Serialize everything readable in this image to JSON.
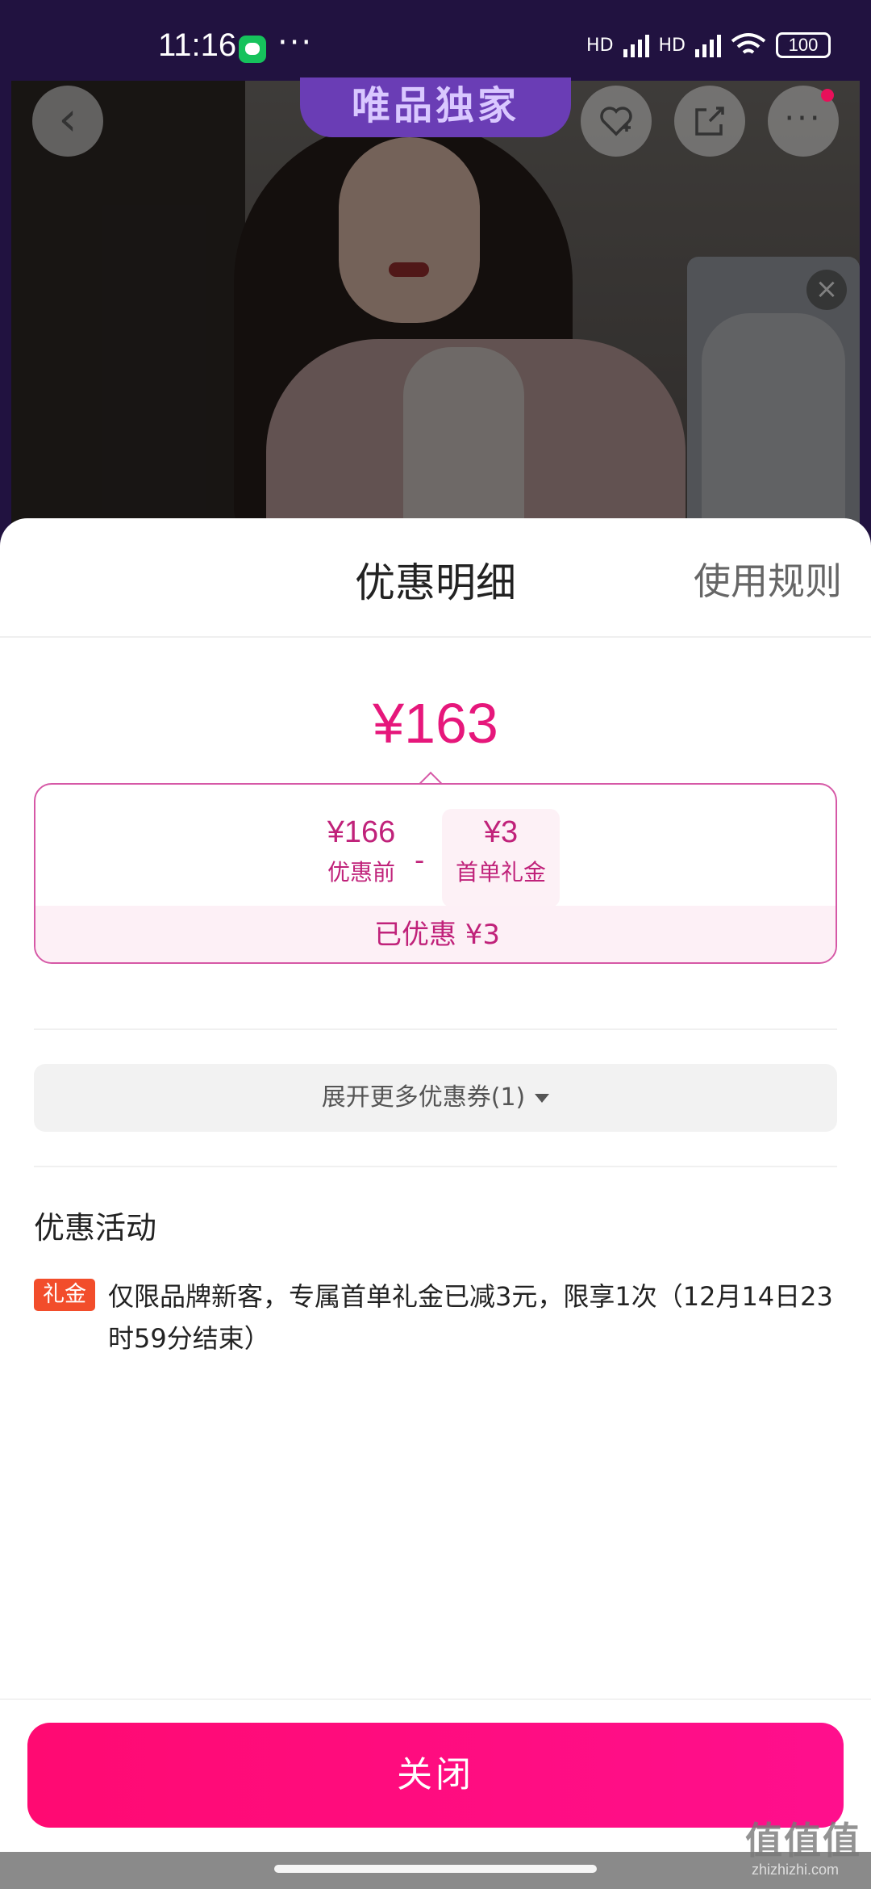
{
  "status_bar": {
    "time": "11:16",
    "dots": "···",
    "signal_label": "HD",
    "battery": "100"
  },
  "product_page": {
    "banner": "唯品独家"
  },
  "sheet": {
    "title": "优惠明细",
    "rules_link": "使用规则",
    "final_price": "¥163",
    "calc": {
      "before_amount": "¥166",
      "before_label": "优惠前",
      "minus": "-",
      "gift_amount": "¥3",
      "gift_label": "首单礼金",
      "saved": "已优惠 ¥3"
    },
    "expand_coupons": "展开更多优惠券(1)",
    "promo_section_title": "优惠活动",
    "promos": [
      {
        "tag": "礼金",
        "text": "仅限品牌新客，专属首单礼金已减3元，限享1次（12月14日23时59分结束）"
      }
    ],
    "close_button": "关闭"
  },
  "watermark": {
    "logo": "值值值",
    "url": "zhizhizhi.com"
  },
  "colors": {
    "accent": "#e6177b",
    "button": "#ff0a72",
    "tag": "#f24d2b"
  }
}
